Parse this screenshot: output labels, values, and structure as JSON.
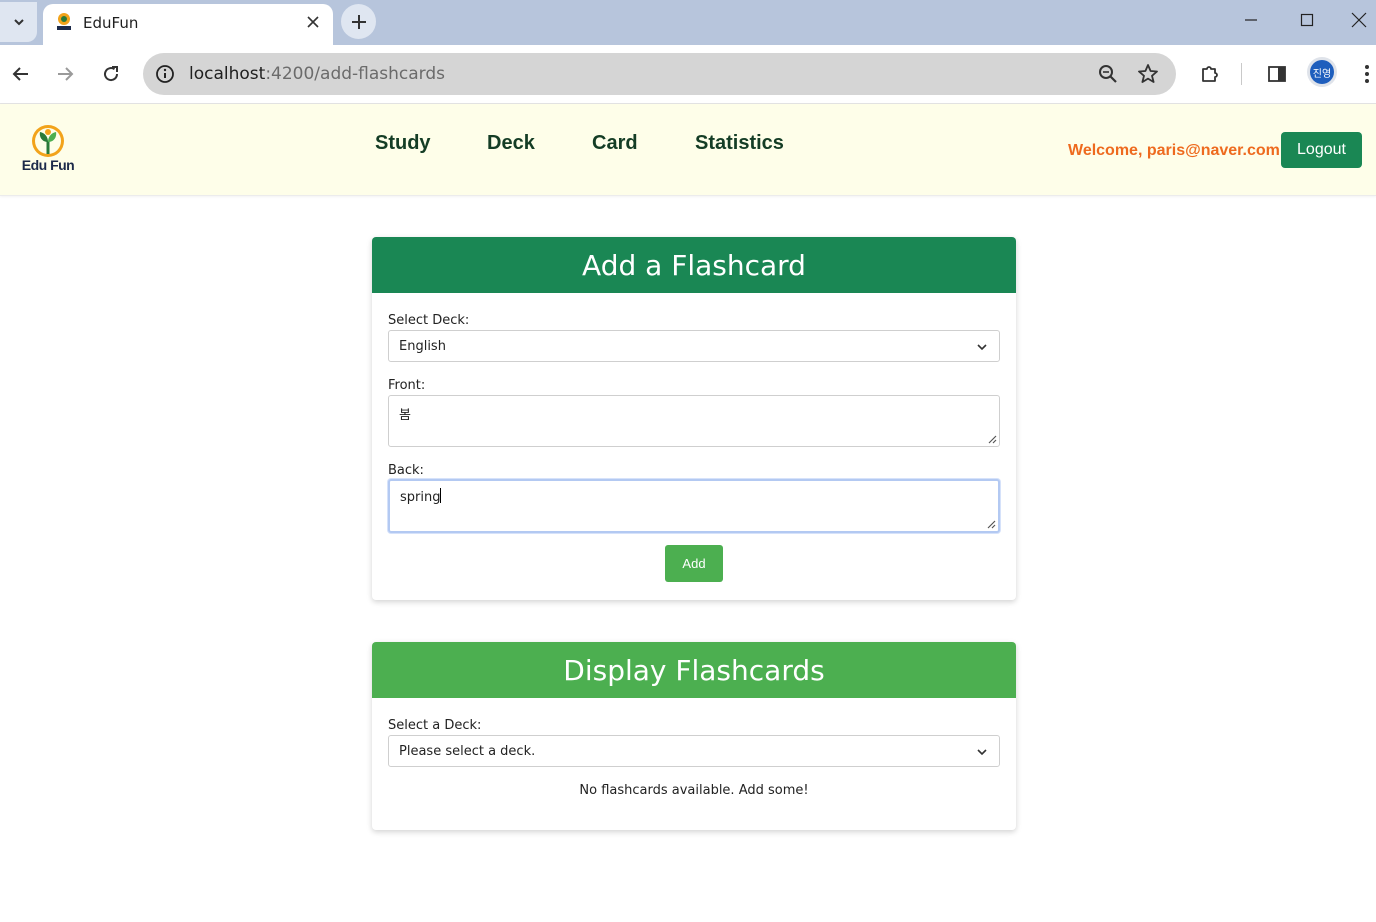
{
  "browser": {
    "tab_title": "EduFun",
    "url_host": "localhost",
    "url_path": ":4200/add-flashcards",
    "profile_initials": "진영"
  },
  "header": {
    "logo_text": "Edu Fun",
    "nav": [
      "Study",
      "Deck",
      "Card",
      "Statistics"
    ],
    "welcome": "Welcome, paris@naver.com!",
    "logout_label": "Logout"
  },
  "add_card": {
    "title": "Add a Flashcard",
    "deck_label": "Select Deck:",
    "deck_value": "English",
    "front_label": "Front:",
    "front_value": "봄",
    "back_label": "Back:",
    "back_value": "spring",
    "add_label": "Add"
  },
  "display_card": {
    "title": "Display Flashcards",
    "deck_label": "Select a Deck:",
    "deck_value": "Please select a deck.",
    "empty_message": "No flashcards available. Add some!"
  },
  "colors": {
    "header_bg": "#fefee9",
    "primary_green": "#1a8754",
    "light_green": "#4caf50",
    "welcome_orange": "#ee6a1e"
  }
}
